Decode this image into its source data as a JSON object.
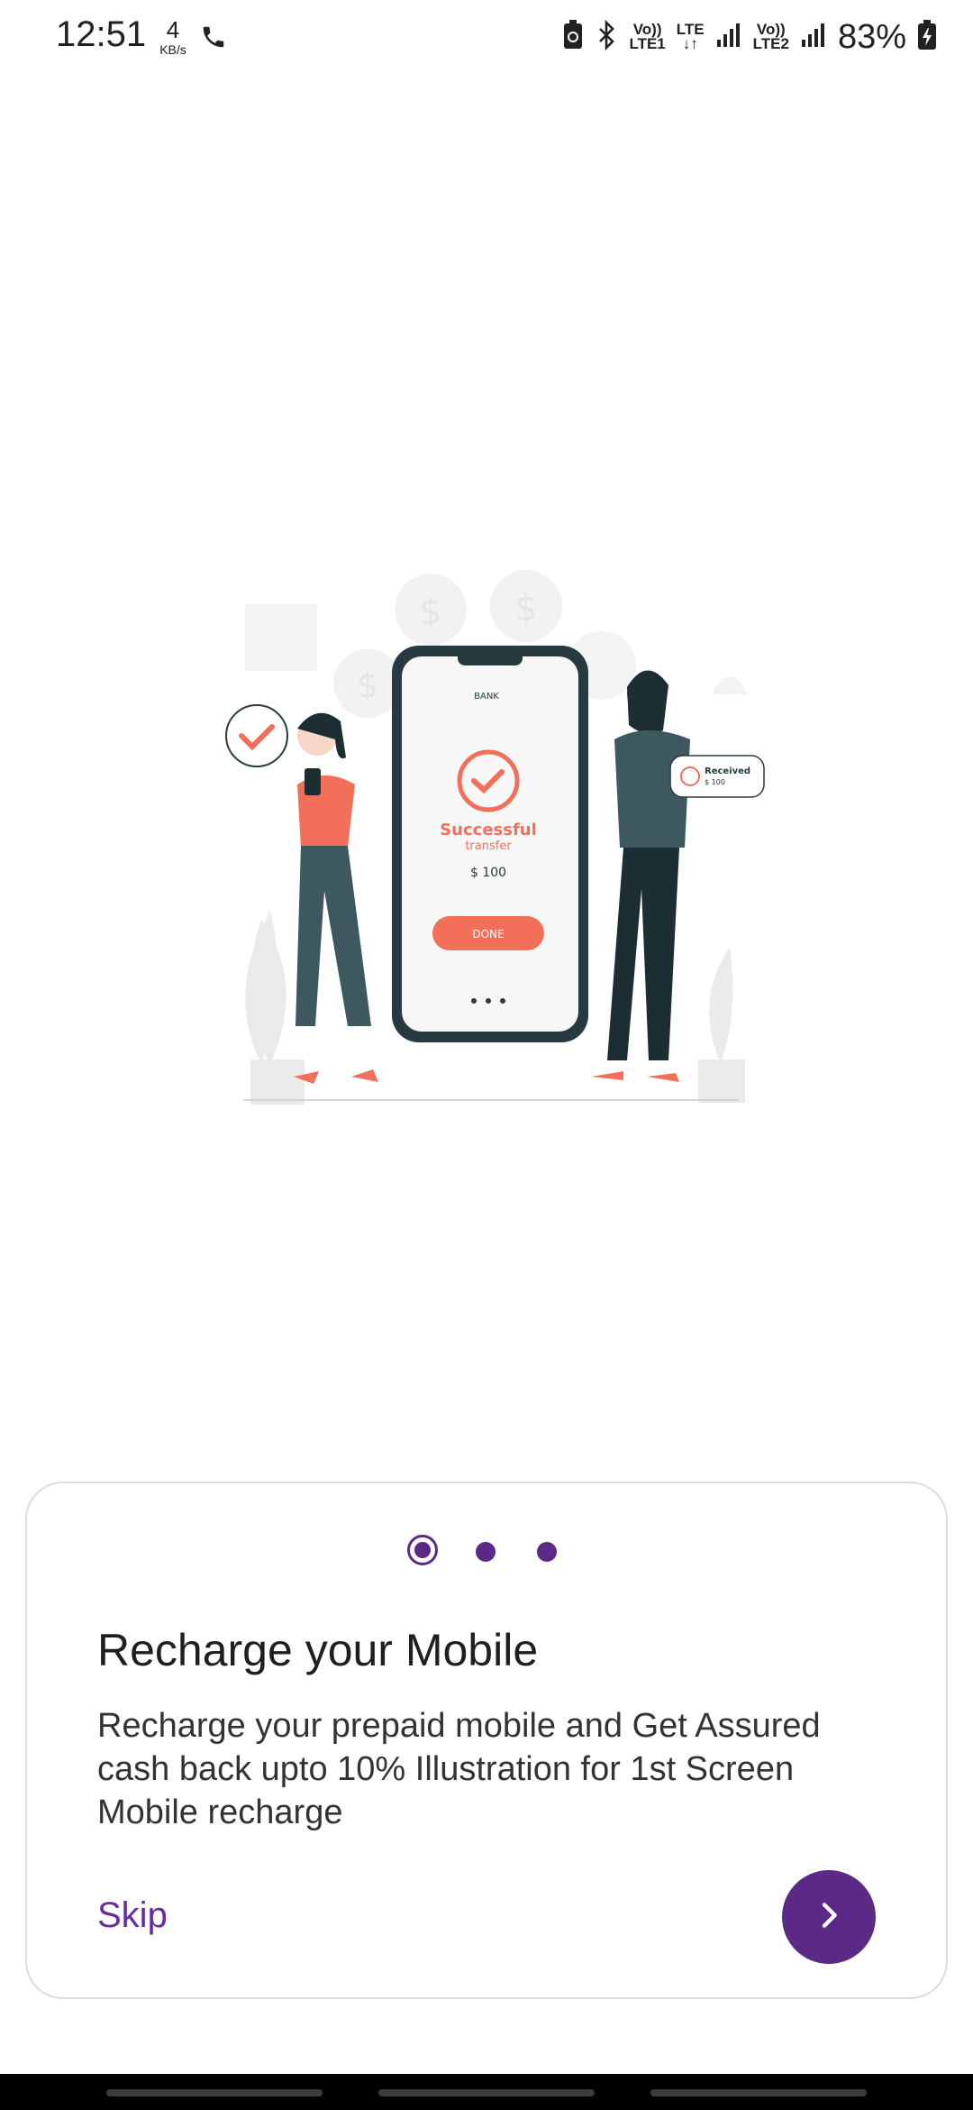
{
  "status_bar": {
    "time": "12:51",
    "net_speed_value": "4",
    "net_speed_unit": "KB/s",
    "sim1": "Vo))\nLTE1",
    "lte": "LTE",
    "sim2": "Vo))\nLTE2",
    "battery": "83%"
  },
  "illustration": {
    "bank_label": "BANK",
    "success_title": "Successful",
    "success_sub": "transfer",
    "amount": "$ 100",
    "done_label": "DONE",
    "received_label": "Received",
    "received_amount": "$ 100",
    "accent_color": "#f2705a"
  },
  "onboarding": {
    "page_indicator": {
      "total": 3,
      "active": 0
    },
    "title": "Recharge your Mobile",
    "description": "Recharge your prepaid mobile and Get Assured cash back upto 10% Illustration for 1st Screen Mobile recharge",
    "skip_label": "Skip",
    "next_icon": "chevron-right-icon",
    "accent_color": "#5a2a86"
  }
}
